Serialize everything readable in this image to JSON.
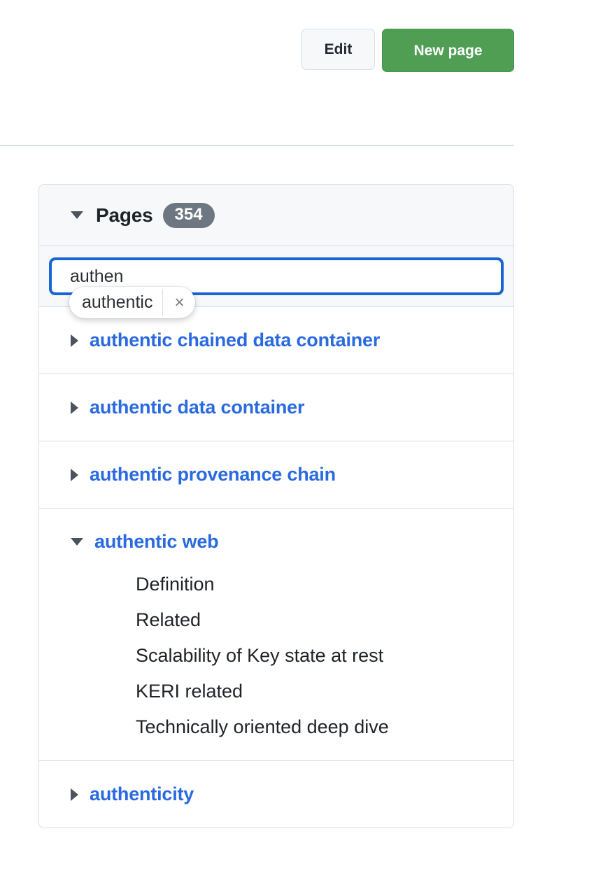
{
  "toolbar": {
    "edit_label": "Edit",
    "new_page_label": "New page",
    "new_page_color": "#4f9e54"
  },
  "panel": {
    "title": "Pages",
    "count": "354",
    "badge_color": "#6e7781",
    "expanded": true
  },
  "search": {
    "value": "authen",
    "placeholder": "",
    "focus_color": "#1a64d4",
    "autofill": {
      "suggestion": "authentic",
      "close_icon": "×"
    }
  },
  "results": [
    {
      "label": "authentic chained data container",
      "expanded": false,
      "children": []
    },
    {
      "label": "authentic data container",
      "expanded": false,
      "children": []
    },
    {
      "label": "authentic provenance chain",
      "expanded": false,
      "children": []
    },
    {
      "label": "authentic web",
      "expanded": true,
      "children": [
        "Definition",
        "Related",
        "Scalability of Key state at rest",
        "KERI related",
        "Technically oriented deep dive"
      ]
    },
    {
      "label": "authenticity",
      "expanded": false,
      "children": []
    }
  ],
  "link_color": "#2a6ae0"
}
